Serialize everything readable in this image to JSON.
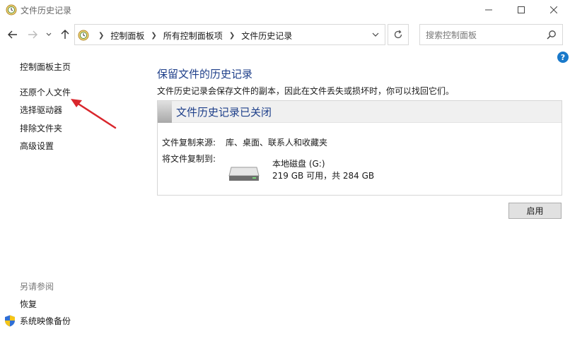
{
  "window": {
    "title": "文件历史记录"
  },
  "address": {
    "crumbs": [
      "控制面板",
      "所有控制面板项",
      "文件历史记录"
    ]
  },
  "search": {
    "placeholder": "搜索控制面板"
  },
  "help_label": "?",
  "left_nav": {
    "home": "控制面板主页",
    "restore": "还原个人文件",
    "select_drive": "选择驱动器",
    "exclude": "排除文件夹",
    "advanced": "高级设置"
  },
  "see_also": {
    "heading": "另请参阅",
    "recovery": "恢复",
    "system_image": "系统映像备份"
  },
  "main": {
    "title": "保留文件的历史记录",
    "description": "文件历史记录会保存文件的副本，因此在文件丢失或损坏时，你可以找回它们。",
    "status_title": "文件历史记录已关闭",
    "source_label": "文件复制来源:",
    "source_value": "库、桌面、联系人和收藏夹",
    "dest_label": "将文件复制到:",
    "drive_name": "本地磁盘 (G:)",
    "drive_space": "219 GB 可用，共 284 GB",
    "enable_button": "启用"
  },
  "colors": {
    "heading_blue": "#1e3f8a",
    "annotation_arrow": "#d9262c",
    "help_blue": "#1979ca"
  }
}
